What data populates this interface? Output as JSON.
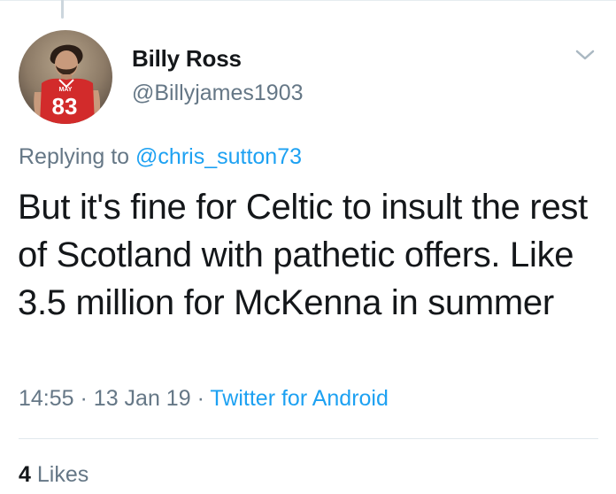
{
  "tweet": {
    "author": {
      "display_name": "Billy Ross",
      "handle": "@Billyjames1903",
      "avatar_icon": "user-avatar-photo",
      "avatar_jersey_number": "83",
      "avatar_jersey_name": "MAY"
    },
    "reply_prefix": "Replying to",
    "reply_to": "@chris_sutton73",
    "text": "But it's fine for Celtic to insult the rest of Scotland with pathetic offers. Like 3.5 million for McKenna in summer",
    "time": "14:55",
    "date": "13 Jan 19",
    "separator": "·",
    "source": "Twitter for Android",
    "likes_count": "4",
    "likes_label": "Likes",
    "menu_icon": "chevron-down-icon"
  },
  "colors": {
    "text_primary": "#14171a",
    "text_secondary": "#657786",
    "link": "#1da1f2",
    "divider": "#e1e8ed"
  }
}
